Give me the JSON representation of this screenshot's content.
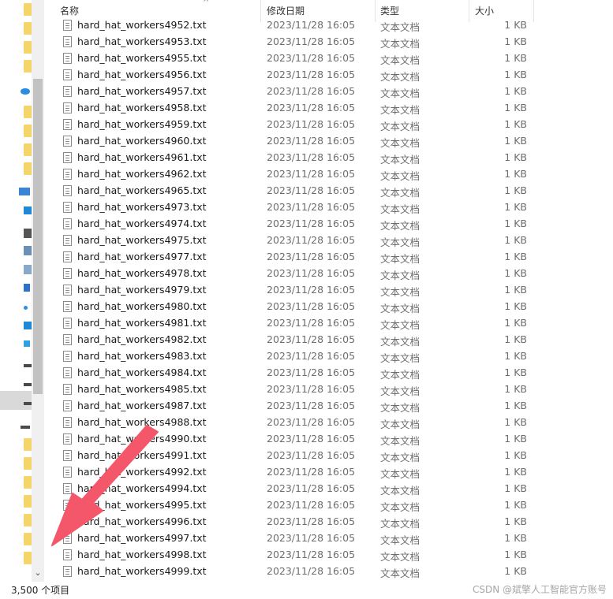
{
  "columns": {
    "name": "名称",
    "date": "修改日期",
    "type": "类型",
    "size": "大小"
  },
  "files": [
    {
      "name": "hard_hat_workers4952.txt",
      "date": "2023/11/28 16:05",
      "type": "文本文档",
      "size": "1 KB"
    },
    {
      "name": "hard_hat_workers4953.txt",
      "date": "2023/11/28 16:05",
      "type": "文本文档",
      "size": "1 KB"
    },
    {
      "name": "hard_hat_workers4955.txt",
      "date": "2023/11/28 16:05",
      "type": "文本文档",
      "size": "1 KB"
    },
    {
      "name": "hard_hat_workers4956.txt",
      "date": "2023/11/28 16:05",
      "type": "文本文档",
      "size": "1 KB"
    },
    {
      "name": "hard_hat_workers4957.txt",
      "date": "2023/11/28 16:05",
      "type": "文本文档",
      "size": "1 KB"
    },
    {
      "name": "hard_hat_workers4958.txt",
      "date": "2023/11/28 16:05",
      "type": "文本文档",
      "size": "1 KB"
    },
    {
      "name": "hard_hat_workers4959.txt",
      "date": "2023/11/28 16:05",
      "type": "文本文档",
      "size": "1 KB"
    },
    {
      "name": "hard_hat_workers4960.txt",
      "date": "2023/11/28 16:05",
      "type": "文本文档",
      "size": "1 KB"
    },
    {
      "name": "hard_hat_workers4961.txt",
      "date": "2023/11/28 16:05",
      "type": "文本文档",
      "size": "1 KB"
    },
    {
      "name": "hard_hat_workers4962.txt",
      "date": "2023/11/28 16:05",
      "type": "文本文档",
      "size": "1 KB"
    },
    {
      "name": "hard_hat_workers4965.txt",
      "date": "2023/11/28 16:05",
      "type": "文本文档",
      "size": "1 KB"
    },
    {
      "name": "hard_hat_workers4973.txt",
      "date": "2023/11/28 16:05",
      "type": "文本文档",
      "size": "1 KB"
    },
    {
      "name": "hard_hat_workers4974.txt",
      "date": "2023/11/28 16:05",
      "type": "文本文档",
      "size": "1 KB"
    },
    {
      "name": "hard_hat_workers4975.txt",
      "date": "2023/11/28 16:05",
      "type": "文本文档",
      "size": "1 KB"
    },
    {
      "name": "hard_hat_workers4977.txt",
      "date": "2023/11/28 16:05",
      "type": "文本文档",
      "size": "1 KB"
    },
    {
      "name": "hard_hat_workers4978.txt",
      "date": "2023/11/28 16:05",
      "type": "文本文档",
      "size": "1 KB"
    },
    {
      "name": "hard_hat_workers4979.txt",
      "date": "2023/11/28 16:05",
      "type": "文本文档",
      "size": "1 KB"
    },
    {
      "name": "hard_hat_workers4980.txt",
      "date": "2023/11/28 16:05",
      "type": "文本文档",
      "size": "1 KB"
    },
    {
      "name": "hard_hat_workers4981.txt",
      "date": "2023/11/28 16:05",
      "type": "文本文档",
      "size": "1 KB"
    },
    {
      "name": "hard_hat_workers4982.txt",
      "date": "2023/11/28 16:05",
      "type": "文本文档",
      "size": "1 KB"
    },
    {
      "name": "hard_hat_workers4983.txt",
      "date": "2023/11/28 16:05",
      "type": "文本文档",
      "size": "1 KB"
    },
    {
      "name": "hard_hat_workers4984.txt",
      "date": "2023/11/28 16:05",
      "type": "文本文档",
      "size": "1 KB"
    },
    {
      "name": "hard_hat_workers4985.txt",
      "date": "2023/11/28 16:05",
      "type": "文本文档",
      "size": "1 KB"
    },
    {
      "name": "hard_hat_workers4987.txt",
      "date": "2023/11/28 16:05",
      "type": "文本文档",
      "size": "1 KB"
    },
    {
      "name": "hard_hat_workers4988.txt",
      "date": "2023/11/28 16:05",
      "type": "文本文档",
      "size": "1 KB"
    },
    {
      "name": "hard_hat_workers4990.txt",
      "date": "2023/11/28 16:05",
      "type": "文本文档",
      "size": "1 KB"
    },
    {
      "name": "hard_hat_workers4991.txt",
      "date": "2023/11/28 16:05",
      "type": "文本文档",
      "size": "1 KB"
    },
    {
      "name": "hard_hat_workers4992.txt",
      "date": "2023/11/28 16:05",
      "type": "文本文档",
      "size": "1 KB"
    },
    {
      "name": "hard_hat_workers4994.txt",
      "date": "2023/11/28 16:05",
      "type": "文本文档",
      "size": "1 KB"
    },
    {
      "name": "hard_hat_workers4995.txt",
      "date": "2023/11/28 16:05",
      "type": "文本文档",
      "size": "1 KB"
    },
    {
      "name": "hard_hat_workers4996.txt",
      "date": "2023/11/28 16:05",
      "type": "文本文档",
      "size": "1 KB"
    },
    {
      "name": "hard_hat_workers4997.txt",
      "date": "2023/11/28 16:05",
      "type": "文本文档",
      "size": "1 KB"
    },
    {
      "name": "hard_hat_workers4998.txt",
      "date": "2023/11/28 16:05",
      "type": "文本文档",
      "size": "1 KB"
    },
    {
      "name": "hard_hat_workers4999.txt",
      "date": "2023/11/28 16:05",
      "type": "文本文档",
      "size": "1 KB"
    }
  ],
  "status": {
    "item_count": "3,500 个项目"
  },
  "watermark": "CSDN @斌擎人工智能官方账号",
  "colors": {
    "annotation_arrow": "#f4566a",
    "folder": "#f5d46a",
    "selection": "#d9d9d9"
  }
}
